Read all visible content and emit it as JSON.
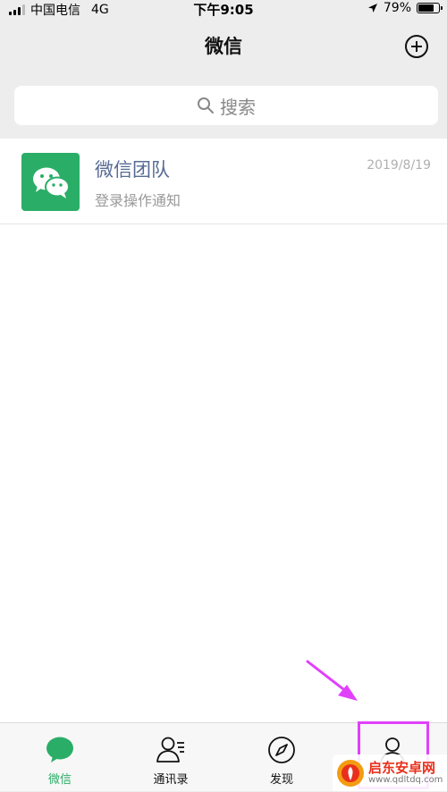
{
  "status_bar": {
    "carrier": "中国电信",
    "network": "4G",
    "time": "下午9:05",
    "battery_percent": "79%",
    "battery_level": 0.79,
    "location_icon": "location-arrow-icon"
  },
  "nav": {
    "title": "微信",
    "add_icon": "plus-circle-icon"
  },
  "search": {
    "placeholder": "搜索",
    "icon": "search-icon"
  },
  "chats": [
    {
      "name": "微信团队",
      "preview": "登录操作通知",
      "time": "2019/8/19",
      "avatar_icon": "wechat-logo-icon",
      "avatar_color": "#2aae67"
    }
  ],
  "tabs": [
    {
      "label": "微信",
      "icon": "chat-bubble-icon",
      "active": true
    },
    {
      "label": "通讯录",
      "icon": "contacts-icon",
      "active": false
    },
    {
      "label": "发现",
      "icon": "compass-icon",
      "active": false
    },
    {
      "label": "",
      "icon": "profile-icon",
      "active": false
    }
  ],
  "annotation": {
    "color": "#e040fb"
  },
  "watermark": {
    "name": "启东安卓网",
    "url": "www.qdltdq.com"
  },
  "colors": {
    "accent": "#2aae67",
    "link_name": "#576b95",
    "background": "#ededed"
  }
}
